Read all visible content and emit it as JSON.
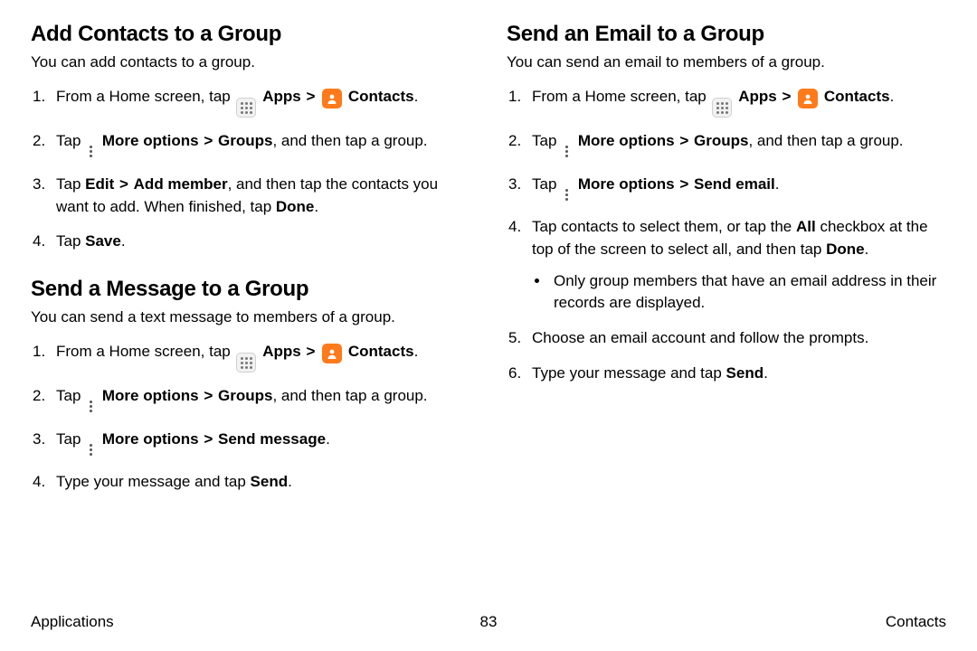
{
  "left": {
    "section1": {
      "heading": "Add Contacts to a Group",
      "intro": "You can add contacts to a group.",
      "step1_a": "From a Home screen, tap ",
      "step1_apps": "Apps",
      "step1_contacts": "Contacts",
      "step2_a": "Tap ",
      "step2_b": "More options",
      "step2_c": "Groups",
      "step2_d": ", and then tap a group.",
      "step3_a": "Tap ",
      "step3_b": "Edit",
      "step3_c": "Add member",
      "step3_d": ", and then tap the contacts you want to add. When finished, tap ",
      "step3_e": "Done",
      "step4_a": "Tap ",
      "step4_b": "Save"
    },
    "section2": {
      "heading": "Send a Message to a Group",
      "intro": "You can send a text message to members of a group.",
      "step1_a": "From a Home screen, tap ",
      "step1_apps": "Apps",
      "step1_contacts": "Contacts",
      "step2_a": "Tap ",
      "step2_b": "More options",
      "step2_c": "Groups",
      "step2_d": ", and then tap a group.",
      "step3_a": "Tap ",
      "step3_b": "More options",
      "step3_c": "Send message",
      "step4_a": "Type your message and tap ",
      "step4_b": "Send"
    }
  },
  "right": {
    "heading": "Send an Email to a Group",
    "intro": "You can send an email to members of a group.",
    "step1_a": "From a Home screen, tap ",
    "step1_apps": "Apps",
    "step1_contacts": "Contacts",
    "step2_a": "Tap ",
    "step2_b": "More options",
    "step2_c": "Groups",
    "step2_d": ", and then tap a group.",
    "step3_a": "Tap ",
    "step3_b": "More options",
    "step3_c": "Send email",
    "step4_a": "Tap contacts to select them, or tap the ",
    "step4_b": "All",
    "step4_c": " checkbox at the top of the screen to select all, and then tap ",
    "step4_d": "Done",
    "step4_sub": "Only group members that have an email address in their records are displayed.",
    "step5": "Choose an email account and follow the prompts.",
    "step6_a": "Type your message and tap ",
    "step6_b": "Send"
  },
  "footer": {
    "left": "Applications",
    "page": "83",
    "right": "Contacts"
  },
  "glyphs": {
    "chevron": ">",
    "period": "."
  }
}
